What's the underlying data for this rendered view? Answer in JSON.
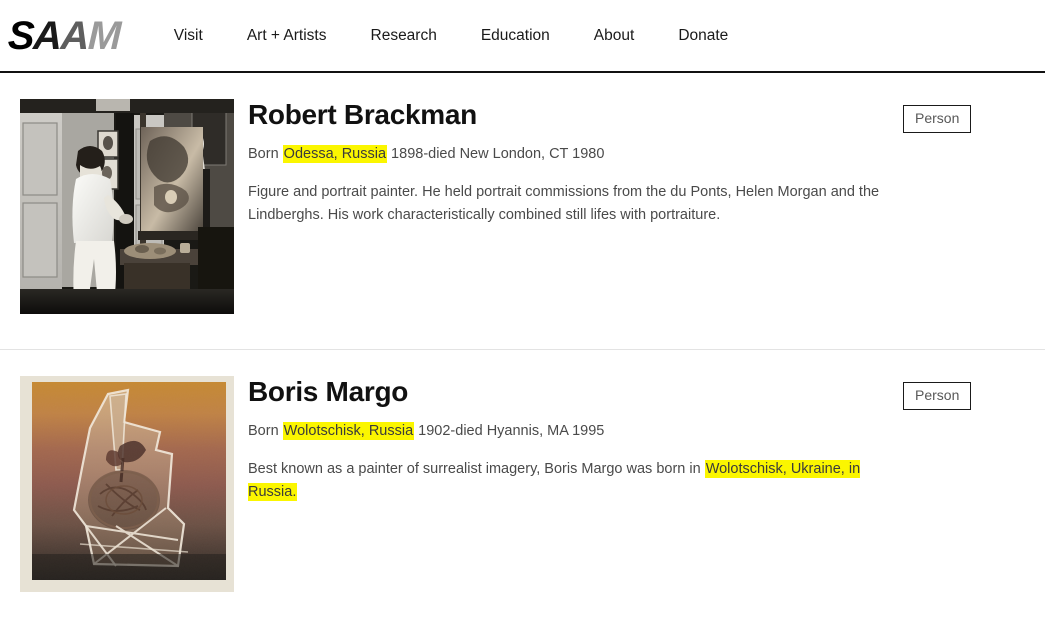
{
  "header": {
    "logo": {
      "name": "SAAM",
      "letters": [
        "S",
        "A",
        "A",
        "M"
      ]
    },
    "nav": [
      {
        "label": "Visit",
        "name": "nav-visit"
      },
      {
        "label": "Art + Artists",
        "name": "nav-art-artists"
      },
      {
        "label": "Research",
        "name": "nav-research"
      },
      {
        "label": "Education",
        "name": "nav-education"
      },
      {
        "label": "About",
        "name": "nav-about"
      },
      {
        "label": "Donate",
        "name": "nav-donate"
      }
    ]
  },
  "results": [
    {
      "title": "Robert Brackman",
      "meta": {
        "prefix": "Born ",
        "highlight": "Odessa, Russia",
        "suffix": " 1898-died New London, CT 1980"
      },
      "description": {
        "text": "Figure and portrait painter. He held portrait commissions from the du Ponts, Helen Morgan and the Lindberghs. His work characteristically combined still lifes with portraiture.",
        "highlight": ""
      },
      "badge": "Person",
      "thumbnail_alt": "Black and white photograph of artist standing in studio beside easel"
    },
    {
      "title": "Boris Margo",
      "meta": {
        "prefix": "Born ",
        "highlight": "Wolotschisk, Russia",
        "suffix": " 1902-died Hyannis, MA 1995"
      },
      "description": {
        "prefix": "Best known as a painter of surrealist imagery, Boris Margo was born in ",
        "highlight": "Wolotschisk, Ukraine, in Russia.",
        "suffix": ""
      },
      "badge": "Person",
      "thumbnail_alt": "Sepia surrealist print of an abstract faceted form"
    }
  ],
  "colors": {
    "highlight": "#fbf600",
    "header_border": "#111111",
    "divider": "#e3e3e3",
    "body_text": "#4a4a4a",
    "title_text": "#111111"
  }
}
